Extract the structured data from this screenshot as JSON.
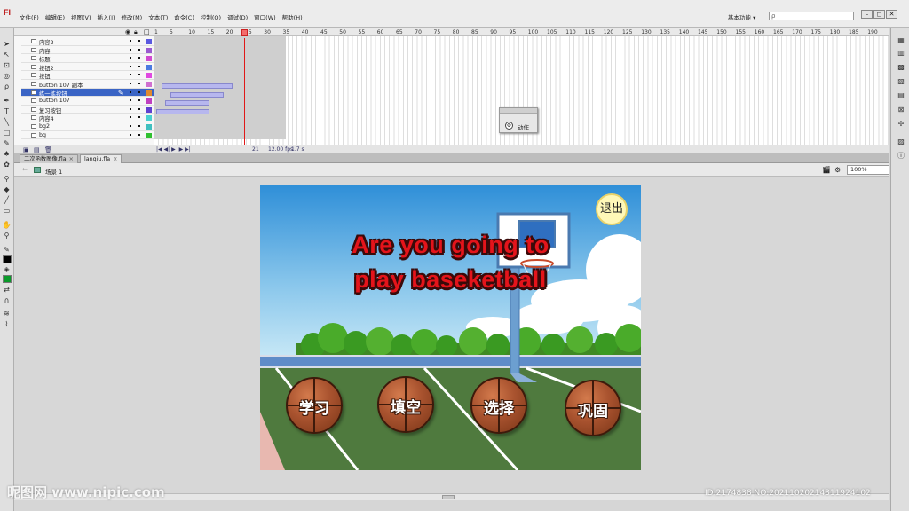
{
  "app": {
    "logo": "Fl",
    "menus": [
      "文件(F)",
      "编辑(E)",
      "视图(V)",
      "插入(I)",
      "修改(M)",
      "文本(T)",
      "命令(C)",
      "控制(O)",
      "调试(D)",
      "窗口(W)",
      "帮助(H)"
    ],
    "workspace": "基本功能 ▾",
    "search_placeholder": "ρ",
    "window_controls": [
      "–",
      "◻",
      "✕"
    ]
  },
  "timeline": {
    "layers": [
      {
        "name": "内容2",
        "color": "#5a5ae0",
        "selected": false
      },
      {
        "name": "内容",
        "color": "#9a5ad0",
        "selected": false
      },
      {
        "name": "标题",
        "color": "#d04ad0",
        "selected": false
      },
      {
        "name": "按钮2",
        "color": "#4a7ae0",
        "selected": false
      },
      {
        "name": "按钮",
        "color": "#e04ae0",
        "selected": false
      },
      {
        "name": "button 107 副本",
        "color": "#d070d0",
        "selected": false
      },
      {
        "name": "练一练按钮",
        "color": "#e08a30",
        "selected": true
      },
      {
        "name": "button 107",
        "color": "#c040c0",
        "selected": false
      },
      {
        "name": "复习按钮",
        "color": "#6040d0",
        "selected": false
      },
      {
        "name": "内容4",
        "color": "#4ad0d0",
        "selected": false
      },
      {
        "name": "bg2",
        "color": "#40c0c0",
        "selected": false
      },
      {
        "name": "bg",
        "color": "#30c030",
        "selected": false
      }
    ],
    "ruler": [
      "1",
      "5",
      "10",
      "15",
      "20",
      "25",
      "30",
      "35",
      "40",
      "45",
      "50",
      "55",
      "60",
      "65",
      "70",
      "75",
      "80",
      "85",
      "90",
      "95",
      "100",
      "105",
      "110",
      "115",
      "120",
      "125",
      "130",
      "135",
      "140",
      "145",
      "150",
      "155",
      "160",
      "165",
      "170",
      "175",
      "180",
      "185",
      "190"
    ],
    "current_frame": "21",
    "fps": "12.00 fps",
    "seconds": "1.7 s",
    "playback": "|◀ ◀| ▶ |▶ ▶|"
  },
  "action_panel": {
    "label": "动作"
  },
  "tabs": [
    {
      "label": "二次函数图像.fla",
      "active": false
    },
    {
      "label": "lanqiu.fla",
      "active": true
    }
  ],
  "editbar": {
    "scene": "场景 1",
    "zoom": "100%"
  },
  "stage": {
    "title_line1": "Are you going to",
    "title_line2": "play baseketball",
    "exit_label": "退出",
    "buttons": [
      "学习",
      "填空",
      "选择",
      "巩固"
    ],
    "colors": {
      "sky_top": "#2f8fd8",
      "sky_bottom": "#bfe4f4",
      "field": "#4f7a3e",
      "title_red": "#e4141b"
    }
  },
  "watermark": {
    "left": "昵图网 www.nipic.com",
    "right": "ID:2174838 NO:20211020214311924102"
  }
}
